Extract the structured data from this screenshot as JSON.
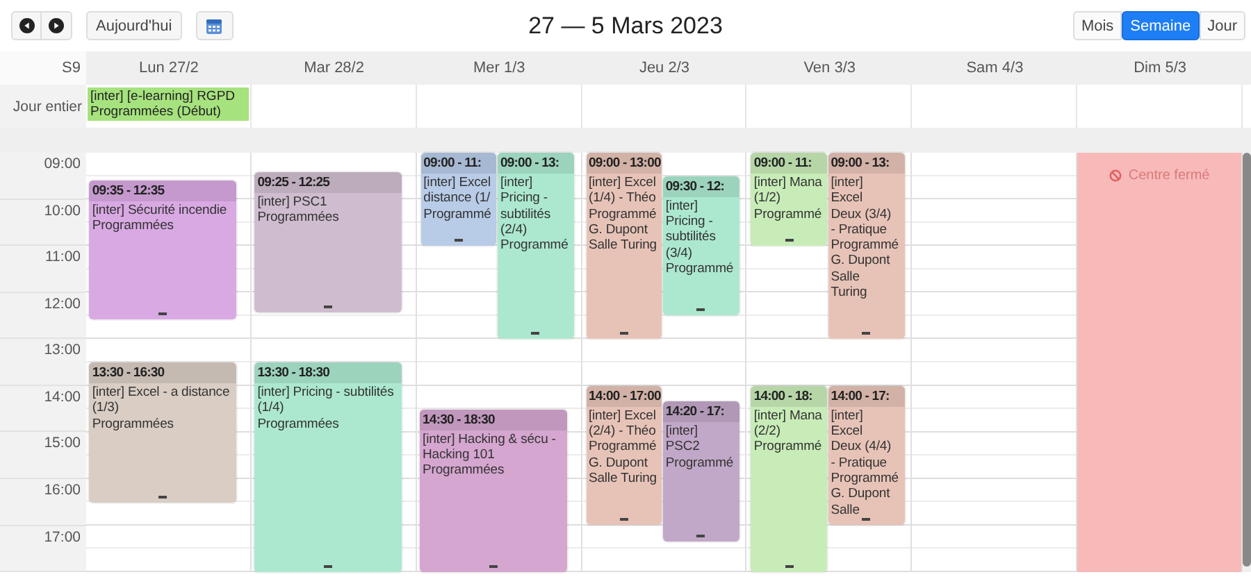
{
  "toolbar": {
    "today": "Aujourd'hui",
    "title": "27 — 5 Mars 2023",
    "views": [
      {
        "label": "Mois",
        "selected": false
      },
      {
        "label": "Semaine",
        "selected": true
      },
      {
        "label": "Jour",
        "selected": false
      }
    ]
  },
  "week_label": "S9",
  "all_day_label": "Jour entier",
  "hours": [
    "09:00",
    "10:00",
    "11:00",
    "12:00",
    "13:00",
    "14:00",
    "15:00",
    "16:00",
    "17:00"
  ],
  "days": [
    {
      "label": "Lun 27/2",
      "all_day": [
        {
          "lines": [
            "[inter] [e-learning] RGPD",
            "Programmées (Début)"
          ],
          "color": "#a6e27e"
        }
      ],
      "events": [
        {
          "time": "09:35 - 12:35",
          "color": "#d9a9e3",
          "lines": [
            "[inter] Sécurité incendie",
            "Programmées"
          ]
        },
        {
          "time": "13:30 - 16:30",
          "color": "#d9cdc4",
          "lines": [
            "[inter] Excel - a distance",
            "(1/3)",
            "Programmées"
          ]
        }
      ]
    },
    {
      "label": "Mar 28/2",
      "events": [
        {
          "time": "09:25 - 12:25",
          "color": "#cfbdcf",
          "lines": [
            "[inter] PSC1",
            "Programmées"
          ]
        },
        {
          "time": "13:30 - 18:30",
          "color": "#ace8cf",
          "lines": [
            "[inter] Pricing - subtilités",
            "(1/4)",
            "Programmées"
          ]
        }
      ]
    },
    {
      "label": "Mer 1/3",
      "events": [
        {
          "time": "09:00 - 11:",
          "color": "#b8cbe7",
          "lines": [
            "[inter] Excel",
            "distance (1/",
            "Programmé"
          ]
        },
        {
          "time": "09:00 - 13:",
          "color": "#ace8cf",
          "lines": [
            "[inter]",
            "Pricing -",
            "subtilités",
            "(2/4)",
            "Programmé"
          ]
        },
        {
          "time": "14:30 - 18:30",
          "color": "#d5a6d0",
          "lines": [
            "[inter] Hacking & sécu -",
            "Hacking 101",
            "Programmées"
          ]
        }
      ]
    },
    {
      "label": "Jeu 2/3",
      "events": [
        {
          "time": "09:00 - 13:00",
          "color": "#e7c3b7",
          "lines": [
            "[inter] Excel",
            "(1/4) - Théo",
            "Programmé",
            "G. Dupont",
            "Salle Turing"
          ]
        },
        {
          "time": "09:30 - 12:",
          "color": "#ace8cf",
          "lines": [
            "[inter]",
            "Pricing -",
            "subtilités",
            "(3/4)",
            "Programmé"
          ]
        },
        {
          "time": "14:00 - 17:00",
          "color": "#e7c3b7",
          "lines": [
            "[inter] Excel",
            "(2/4) - Théo",
            "Programmé",
            "G. Dupont",
            "Salle Turing"
          ]
        },
        {
          "time": "14:20 - 17:",
          "color": "#c2a8c8",
          "lines": [
            "[inter]",
            "PSC2",
            "Programmé"
          ]
        }
      ]
    },
    {
      "label": "Ven 3/3",
      "events": [
        {
          "time": "09:00 - 11:",
          "color": "#c8ecb8",
          "lines": [
            "[inter] Mana",
            "(1/2)",
            "Programmé"
          ]
        },
        {
          "time": "09:00 - 13:",
          "color": "#e7c3b7",
          "lines": [
            "[inter]",
            "Excel",
            "Deux (3/4)",
            "- Pratique",
            "Programmé",
            "G. Dupont",
            "Salle",
            "Turing"
          ]
        },
        {
          "time": "14:00 - 18:",
          "color": "#c8ecb8",
          "lines": [
            "[inter] Mana",
            "(2/2)",
            "Programmé"
          ]
        },
        {
          "time": "14:00 - 17:",
          "color": "#e7c3b7",
          "lines": [
            "[inter]",
            "Excel",
            "Deux (4/4)",
            "- Pratique",
            "Programmé",
            "G. Dupont",
            "Salle"
          ]
        }
      ]
    },
    {
      "label": "Sam 4/3"
    },
    {
      "label": "Dim 5/3",
      "closure": {
        "text": "Centre fermé"
      }
    }
  ]
}
